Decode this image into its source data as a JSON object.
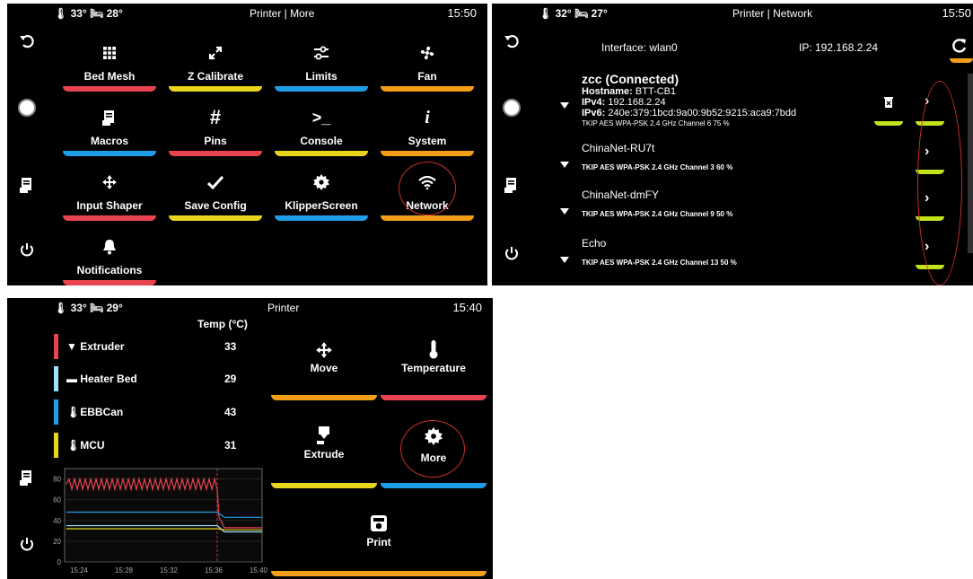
{
  "more_screen": {
    "temps": "🌡 33°  🛏 28°",
    "title": "Printer | More",
    "clock": "15:50",
    "tiles": [
      {
        "label": "Bed Mesh",
        "icon": "grid-icon"
      },
      {
        "label": "Z Calibrate",
        "icon": "expand-icon"
      },
      {
        "label": "Limits",
        "icon": "sliders-icon"
      },
      {
        "label": "Fan",
        "icon": "fan-icon"
      },
      {
        "label": "Macros",
        "icon": "macro-icon"
      },
      {
        "label": "Pins",
        "icon": "hash-icon"
      },
      {
        "label": "Console",
        "icon": "terminal-icon"
      },
      {
        "label": "System",
        "icon": "info-icon"
      },
      {
        "label": "Input Shaper",
        "icon": "move-icon"
      },
      {
        "label": "Save Config",
        "icon": "check-icon"
      },
      {
        "label": "KlipperScreen",
        "icon": "gear-icon"
      },
      {
        "label": "Network",
        "icon": "wifi-icon"
      },
      {
        "label": "Notifications",
        "icon": "bell-icon"
      }
    ]
  },
  "network_screen": {
    "temps": "🌡 32°  🛏 27°",
    "title": "Printer | Network",
    "clock": "15:50",
    "interface": "Interface: wlan0",
    "ip": "IP: 192.168.2.24",
    "connected": {
      "name": "zcc (Connected)",
      "hostname_label": "Hostname:",
      "hostname": "BTT-CB1",
      "ipv4_label": "IPv4:",
      "ipv4": "192.168.2.24",
      "ipv6_label": "IPv6:",
      "ipv6": "240e:379:1bcd:9a00:9b52:9215:aca9:7bdd",
      "security": "TKIP AES WPA-PSK  2.4 GHz  Channel 6  75 %"
    },
    "networks": [
      {
        "name": "ChinaNet-RU7t",
        "info": "TKIP AES WPA-PSK  2.4 GHz  Channel 3  60 %"
      },
      {
        "name": "ChinaNet-dmFY",
        "info": "TKIP AES WPA-PSK  2.4 GHz  Channel 9  50 %"
      },
      {
        "name": "Echo",
        "info": "TKIP AES WPA-PSK  2.4 GHz  Channel 13  50 %"
      }
    ]
  },
  "main_screen": {
    "temps": "🌡 33°  🛏 29°",
    "title": "Printer",
    "clock": "15:40",
    "temp_header": "Temp (°C)",
    "heaters": [
      {
        "name": "Extruder",
        "value": "33",
        "color": "#e8434f"
      },
      {
        "name": "Heater Bed",
        "value": "29",
        "color": "#9fe3ff"
      },
      {
        "name": "EBBCan",
        "value": "43",
        "color": "#1e9ee8"
      },
      {
        "name": "MCU",
        "value": "31",
        "color": "#e8d51c"
      }
    ],
    "buttons": {
      "move": "Move",
      "temperature": "Temperature",
      "extrude": "Extrude",
      "more": "More",
      "print": "Print"
    },
    "graph": {
      "y_ticks": [
        "80",
        "60",
        "40",
        "20",
        "0"
      ],
      "x_ticks": [
        "15:24",
        "15:28",
        "15:32",
        "15:36",
        "15:40"
      ]
    }
  },
  "chart_data": {
    "type": "line",
    "x": [
      "15:24",
      "15:28",
      "15:32",
      "15:36",
      "15:40"
    ],
    "ylim": [
      0,
      90
    ],
    "series": [
      {
        "name": "Extruder",
        "values": [
          75,
          75,
          75,
          75,
          33
        ],
        "color": "#e8434f"
      },
      {
        "name": "Heater Bed",
        "values": [
          35,
          35,
          35,
          35,
          29
        ],
        "color": "#9fe3ff"
      },
      {
        "name": "EBBCan",
        "values": [
          48,
          48,
          48,
          48,
          43
        ],
        "color": "#1e9ee8"
      },
      {
        "name": "MCU",
        "values": [
          32,
          32,
          32,
          32,
          31
        ],
        "color": "#e8d51c"
      }
    ]
  }
}
